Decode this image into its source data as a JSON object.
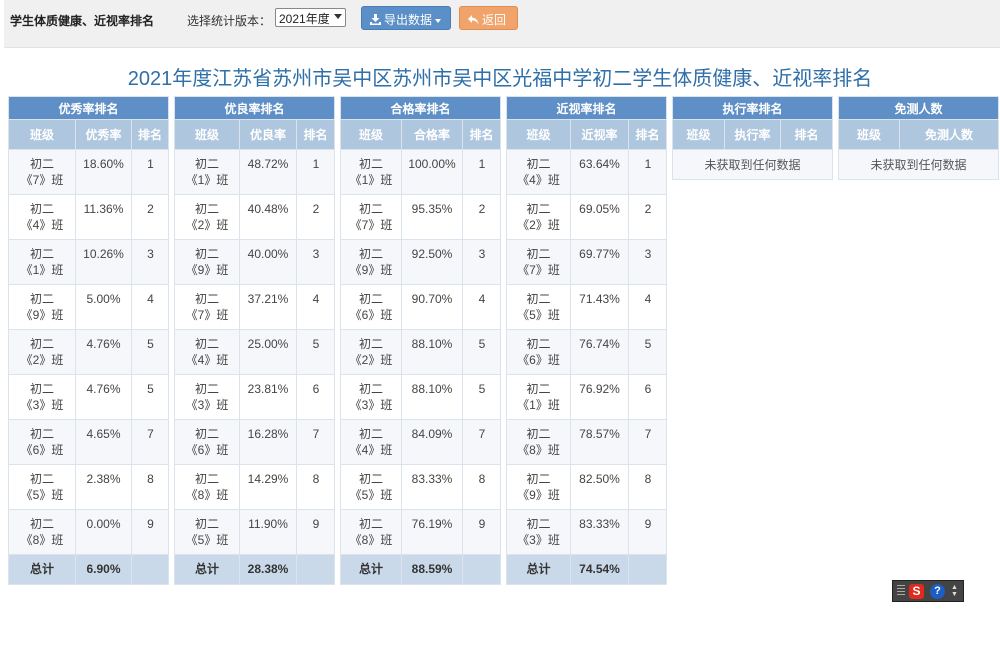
{
  "header": {
    "page_title": "学生体质健康、近视率排名",
    "version_label": "选择统计版本：",
    "version_selected": "2021年度",
    "export_label": "导出数据",
    "back_label": "返回"
  },
  "main_title": "2021年度江苏省苏州市吴中区苏州市吴中区光福中学初二学生体质健康、近视率排名",
  "tables": [
    {
      "title": "优秀率排名",
      "columns": [
        "班级",
        "优秀率",
        "排名"
      ],
      "rows": [
        [
          "初二",
          "《7》班",
          "18.60%",
          "1"
        ],
        [
          "初二",
          "《4》班",
          "11.36%",
          "2"
        ],
        [
          "初二",
          "《1》班",
          "10.26%",
          "3"
        ],
        [
          "初二",
          "《9》班",
          "5.00%",
          "4"
        ],
        [
          "初二",
          "《2》班",
          "4.76%",
          "5"
        ],
        [
          "初二",
          "《3》班",
          "4.76%",
          "5"
        ],
        [
          "初二",
          "《6》班",
          "4.65%",
          "7"
        ],
        [
          "初二",
          "《5》班",
          "2.38%",
          "8"
        ],
        [
          "初二",
          "《8》班",
          "0.00%",
          "9"
        ]
      ],
      "total_label": "总计",
      "total_value": "6.90%"
    },
    {
      "title": "优良率排名",
      "columns": [
        "班级",
        "优良率",
        "排名"
      ],
      "rows": [
        [
          "初二",
          "《1》班",
          "48.72%",
          "1"
        ],
        [
          "初二",
          "《2》班",
          "40.48%",
          "2"
        ],
        [
          "初二",
          "《9》班",
          "40.00%",
          "3"
        ],
        [
          "初二",
          "《7》班",
          "37.21%",
          "4"
        ],
        [
          "初二",
          "《4》班",
          "25.00%",
          "5"
        ],
        [
          "初二",
          "《3》班",
          "23.81%",
          "6"
        ],
        [
          "初二",
          "《6》班",
          "16.28%",
          "7"
        ],
        [
          "初二",
          "《8》班",
          "14.29%",
          "8"
        ],
        [
          "初二",
          "《5》班",
          "11.90%",
          "9"
        ]
      ],
      "total_label": "总计",
      "total_value": "28.38%"
    },
    {
      "title": "合格率排名",
      "columns": [
        "班级",
        "合格率",
        "排名"
      ],
      "rows": [
        [
          "初二",
          "《1》班",
          "100.00%",
          "1"
        ],
        [
          "初二",
          "《7》班",
          "95.35%",
          "2"
        ],
        [
          "初二",
          "《9》班",
          "92.50%",
          "3"
        ],
        [
          "初二",
          "《6》班",
          "90.70%",
          "4"
        ],
        [
          "初二",
          "《2》班",
          "88.10%",
          "5"
        ],
        [
          "初二",
          "《3》班",
          "88.10%",
          "5"
        ],
        [
          "初二",
          "《4》班",
          "84.09%",
          "7"
        ],
        [
          "初二",
          "《5》班",
          "83.33%",
          "8"
        ],
        [
          "初二",
          "《8》班",
          "76.19%",
          "9"
        ]
      ],
      "total_label": "总计",
      "total_value": "88.59%"
    },
    {
      "title": "近视率排名",
      "columns": [
        "班级",
        "近视率",
        "排名"
      ],
      "rows": [
        [
          "初二",
          "《4》班",
          "63.64%",
          "1"
        ],
        [
          "初二",
          "《2》班",
          "69.05%",
          "2"
        ],
        [
          "初二",
          "《7》班",
          "69.77%",
          "3"
        ],
        [
          "初二",
          "《5》班",
          "71.43%",
          "4"
        ],
        [
          "初二",
          "《6》班",
          "76.74%",
          "5"
        ],
        [
          "初二",
          "《1》班",
          "76.92%",
          "6"
        ],
        [
          "初二",
          "《8》班",
          "78.57%",
          "7"
        ],
        [
          "初二",
          "《9》班",
          "82.50%",
          "8"
        ],
        [
          "初二",
          "《3》班",
          "83.33%",
          "9"
        ]
      ],
      "total_label": "总计",
      "total_value": "74.54%"
    }
  ],
  "exec_table": {
    "title": "执行率排名",
    "columns": [
      "班级",
      "执行率",
      "排名"
    ],
    "empty_text": "未获取到任何数据"
  },
  "exempt_table": {
    "title": "免测人数",
    "columns": [
      "班级",
      "免测人数"
    ],
    "empty_text": "未获取到任何数据"
  },
  "colors": {
    "group_header": "#5e8fc6",
    "column_header": "#aec6de",
    "total_row": "#c9d9e9",
    "title_text": "#2f6fa8",
    "export_button": "#5b8fc7",
    "back_button": "#f0a36a"
  },
  "icons": {
    "export": "download-icon",
    "back": "reply-arrow-icon",
    "tray_s": "sogou-s-icon",
    "tray_help": "help-icon"
  },
  "tray": {
    "s_glyph": "S",
    "help_glyph": "?"
  }
}
